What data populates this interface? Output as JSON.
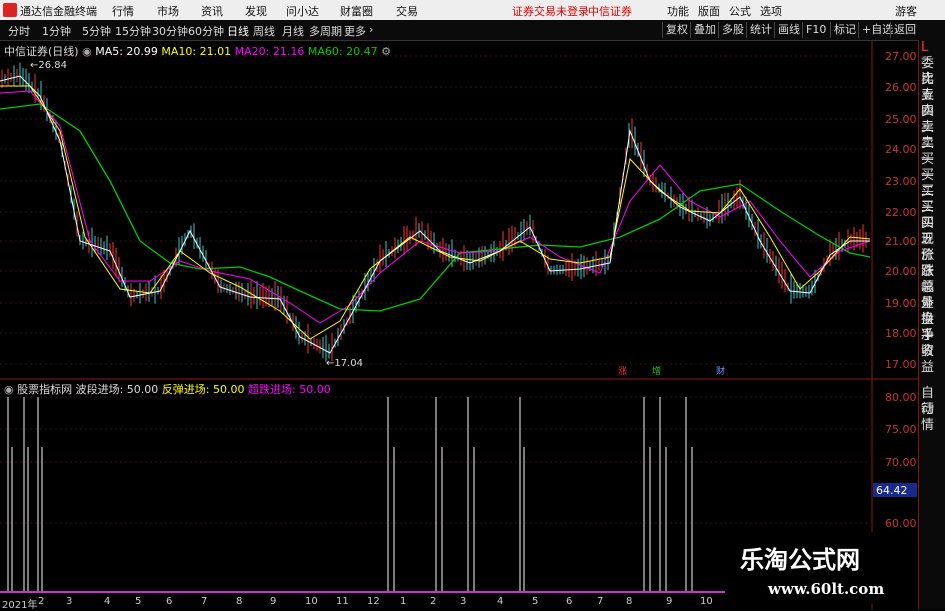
{
  "menubar": {
    "app_title": "通达信金融终端",
    "items": [
      "行情",
      "市场",
      "资讯",
      "发现",
      "问小达",
      "财富圈",
      "交易"
    ],
    "notice": "证券交易未登录",
    "broker": "中信证券",
    "right_items": [
      "功能",
      "版面",
      "公式",
      "选项"
    ],
    "guest": "游客"
  },
  "toolbar": {
    "periods": [
      "分时",
      "1分钟",
      "5分钟",
      "15分钟",
      "30分钟",
      "60分钟",
      "日线",
      "周线",
      "月线",
      "多周期",
      "更多"
    ],
    "right_buttons": [
      "复权",
      "叠加",
      "多股",
      "统计",
      "画线",
      "F10",
      "标记",
      "+自选",
      "返回"
    ]
  },
  "main_chart": {
    "stock": "中信证券(日线)",
    "ma5": "MA5: 20.99",
    "ma10": "MA10: 21.01",
    "ma20": "MA20: 21.16",
    "ma60": "MA60: 20.47",
    "high_label": "26.84",
    "low_label": "17.04",
    "y_ticks": [
      "27.00",
      "26.00",
      "25.00",
      "24.00",
      "23.00",
      "22.00",
      "21.00",
      "20.00",
      "19.00",
      "18.00",
      "17.00"
    ],
    "markers": [
      "涨",
      "增",
      "财"
    ]
  },
  "indicator": {
    "name": "股票指标网",
    "l1": "波段进场: 50.00",
    "l2": "反弹进场: 50.00",
    "l3": "超跌进场: 50.00",
    "y_ticks": [
      "80.00",
      "75.00",
      "70.00",
      "60.00"
    ],
    "current": "64.42"
  },
  "side_panel": {
    "top": "L",
    "items": [
      "委比",
      "卖五",
      "卖四",
      "卖三",
      "卖二",
      "卖一",
      "买一",
      "买二",
      "买三",
      "买四",
      "买五",
      "现价",
      "涨跌",
      "涨幅",
      "总量",
      "外盘",
      "换手",
      "净资",
      "收益"
    ],
    "bottom_items": [
      "自动",
      "行情"
    ]
  },
  "x_axis": [
    "2021年",
    "2",
    "3",
    "4",
    "5",
    "6",
    "7",
    "8",
    "9",
    "10",
    "11",
    "12",
    "1",
    "2",
    "3",
    "4",
    "5",
    "6",
    "7",
    "8",
    "9",
    "10"
  ],
  "watermark": {
    "cn": "乐淘公式网",
    "url": "www.60lt.com"
  },
  "colors": {
    "up": "#ff3333",
    "ma5": "#ffffff",
    "ma10": "#ffff00",
    "ma20": "#ff00ff",
    "ma60": "#00cc00"
  }
}
